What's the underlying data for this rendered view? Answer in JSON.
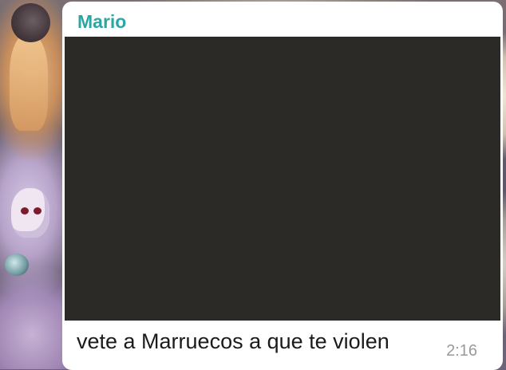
{
  "chat": {
    "message": {
      "sender_name": "Mario",
      "sender_name_color": "#2ba6a0",
      "text": "vete a Marruecos a que te violen",
      "time": "2:16",
      "media": {
        "kind": "image",
        "content_visible": false,
        "fill_color": "#2b2a27"
      }
    },
    "bubble_color": "#ffffff",
    "wallpaper": "illustrated-wallpaper"
  }
}
